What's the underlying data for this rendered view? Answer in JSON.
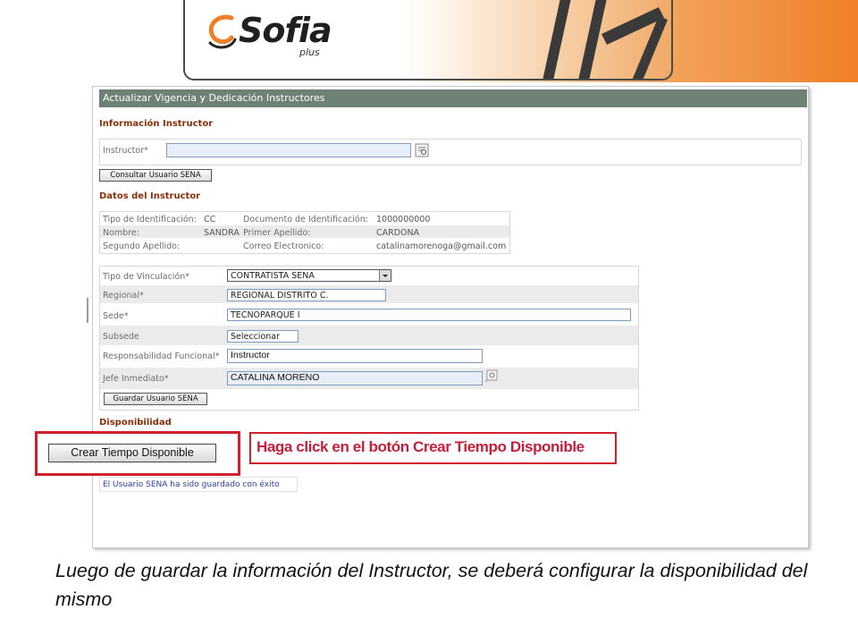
{
  "banner": {
    "logo_main": "Sofia",
    "logo_sub": "plus"
  },
  "panel": {
    "title": "Actualizar Vigencia y Dedicación Instructores",
    "info_section": "Información Instructor",
    "instructor_label": "Instructor*",
    "instructor_value": "",
    "consult_button": "Consultar Usuario SENA",
    "datos_section": "Datos del Instructor",
    "datos": {
      "tipo_id_label": "Tipo de Identificación:",
      "tipo_id_value": "CC",
      "doc_label": "Documento de Identificación:",
      "doc_value": "1000000000",
      "nombre_label": "Nombre:",
      "nombre_value": "SANDRA",
      "primer_apellido_label": "Primer Apellido:",
      "primer_apellido_value": "CARDONA",
      "segundo_apellido_label": "Segundo Apellido:",
      "segundo_apellido_value": "",
      "correo_label": "Correo Electronico:",
      "correo_value": "catalinamorenoga@gmail.com"
    },
    "form": {
      "vinculacion_label": "Tipo de Vinculación*",
      "vinculacion_value": "CONTRATISTA SENA",
      "regional_label": "Regional*",
      "regional_value": "REGIONAL DISTRITO C.",
      "sede_label": "Sede*",
      "sede_value": "TECNOPARQUE I",
      "subsede_label": "Subsede",
      "subsede_value": "Seleccionar",
      "responsabilidad_label": "Responsabilidad Funcional*",
      "responsabilidad_value": "Instructor",
      "jefe_label": "Jefe Inmediato*",
      "jefe_value": "CATALINA MORENO",
      "save_button": "Guardar Usuario SENA"
    },
    "disponibilidad_section": "Disponibilidad",
    "crear_button": "Crear Tiempo Disponible",
    "success_message": "El Usuario SENA ha sido guardado con éxito"
  },
  "callout_text": "Haga click en el botón Crear Tiempo Disponible",
  "caption": "Luego de guardar  la información  del Instructor, se deberá configurar  la disponibilidad  del mismo",
  "colors": {
    "accent_orange": "#ef7f27",
    "callout_red": "#d0202e",
    "section_title": "#8b2f08",
    "title_bar": "#6d8274"
  }
}
